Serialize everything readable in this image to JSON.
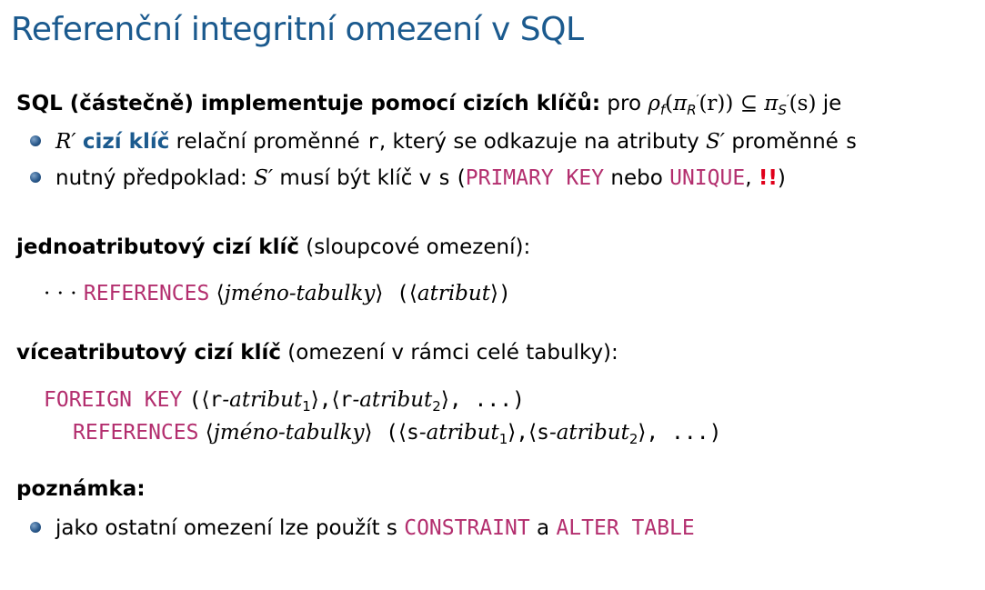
{
  "slide": {
    "title": "Referenční integritní omezení v SQL",
    "intro": {
      "bold": "SQL (částečně) implementuje pomocí cizích klíčů:",
      "pre": "pro",
      "rho": "ρ",
      "rho_sub": "f",
      "open1": "(",
      "pi1": "π",
      "pi1_sub": "R",
      "pi1_sub_prime": "′",
      "arg1": "(r)",
      "close1": ")",
      "subset": "⊆",
      "pi2": "π",
      "pi2_sub": "S",
      "pi2_sub_prime": "′",
      "arg2": "(s)",
      "post": "je"
    },
    "bullet1": {
      "var": "R′",
      "bold": "cizí klíč",
      "text1": "relační proměnné",
      "r": "r",
      "text2": ", který se odkazuje na atributy",
      "var2": "S′",
      "text3": "proměnné",
      "s": "s"
    },
    "bullet2": {
      "text1": "nutný předpoklad:",
      "var": "S′",
      "text2": "musí být klíč v",
      "s": "s",
      "paren_open": "(",
      "kw1": "PRIMARY KEY",
      "text3": "nebo",
      "kw2": "UNIQUE",
      "comma": ",",
      "excl": "!!",
      "paren_close": ")"
    },
    "single": {
      "bold": "jednoatributový cizí klíč",
      "text": "(sloupcové omezení):"
    },
    "single_code": {
      "dots": "· · ·",
      "kw": "REFERENCES",
      "lang1": "⟨",
      "name": "jméno-tabulky",
      "rang1": "⟩",
      "paren_open": "(",
      "lang2": "⟨",
      "attr": "atribut",
      "rang2": "⟩",
      "paren_close": ")"
    },
    "multi": {
      "bold": "víceatributový cizí klíč",
      "text": "(omezení v rámci celé tabulky):"
    },
    "multi_code1": {
      "kw": "FOREIGN KEY",
      "paren_open": "(",
      "l1": "⟨",
      "r1": "r",
      "attr1": "-atribut",
      "sub1": "1",
      "g1": "⟩",
      "comma1": ",",
      "l2": "⟨",
      "r2": "r",
      "attr2": "-atribut",
      "sub2": "2",
      "g2": "⟩",
      "rest": ", ...)"
    },
    "multi_code2": {
      "kw": "REFERENCES",
      "l0": "⟨",
      "name": "jméno-tabulky",
      "g0": "⟩",
      "paren_open": "(",
      "l1": "⟨",
      "s1": "s",
      "attr1": "-atribut",
      "sub1": "1",
      "g1": "⟩",
      "comma1": ",",
      "l2": "⟨",
      "s2": "s",
      "attr2": "-atribut",
      "sub2": "2",
      "g2": "⟩",
      "rest": ", ...)"
    },
    "note": {
      "bold": "poznámka:"
    },
    "bullet3": {
      "text1": "jako ostatní omezení lze použít s",
      "kw1": "CONSTRAINT",
      "text2": "a",
      "kw2": "ALTER TABLE"
    },
    "colors": {
      "title": "#1b5a8e",
      "keyword": "#b32e6e",
      "accent_bold": "#1b5a8e",
      "alert": "#e0001a"
    }
  }
}
